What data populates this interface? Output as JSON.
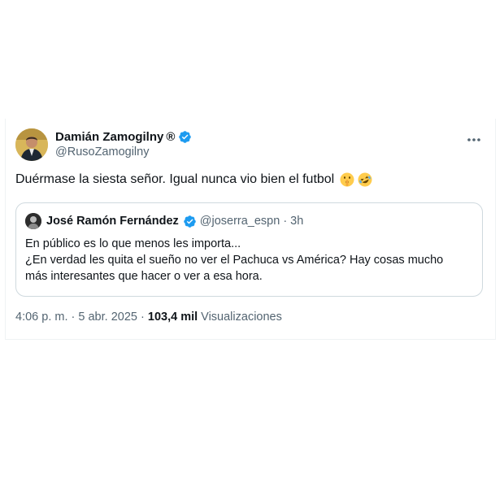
{
  "tweet": {
    "author": {
      "name": "Damián Zamogilny",
      "registered_mark": "®",
      "handle": "@RusoZamogilny"
    },
    "text": "Duérmase la siesta señor. Igual nunca vio bien el futbol",
    "emojis": [
      "shushing-face-icon",
      "rolling-on-floor-laughing-icon"
    ],
    "quoted": {
      "author_name": "José Ramón Fernández",
      "handle": "@joserra_espn",
      "separator": "·",
      "time": "3h",
      "lines": [
        "En público es lo que menos les importa...",
        "¿En verdad les quita el sueño no ver el Pachuca vs América? Hay cosas mucho",
        "más interesantes que hacer o ver a esa hora."
      ]
    },
    "meta": {
      "time": "4:06 p. m.",
      "separator1": "·",
      "date": "5 abr. 2025",
      "separator2": "·",
      "views_count": "103,4 mil",
      "views_label": "Visualizaciones"
    }
  },
  "colors": {
    "verified": "#1d9bf0",
    "text_primary": "#0f1419",
    "text_secondary": "#536471",
    "border": "#cfd9de"
  }
}
